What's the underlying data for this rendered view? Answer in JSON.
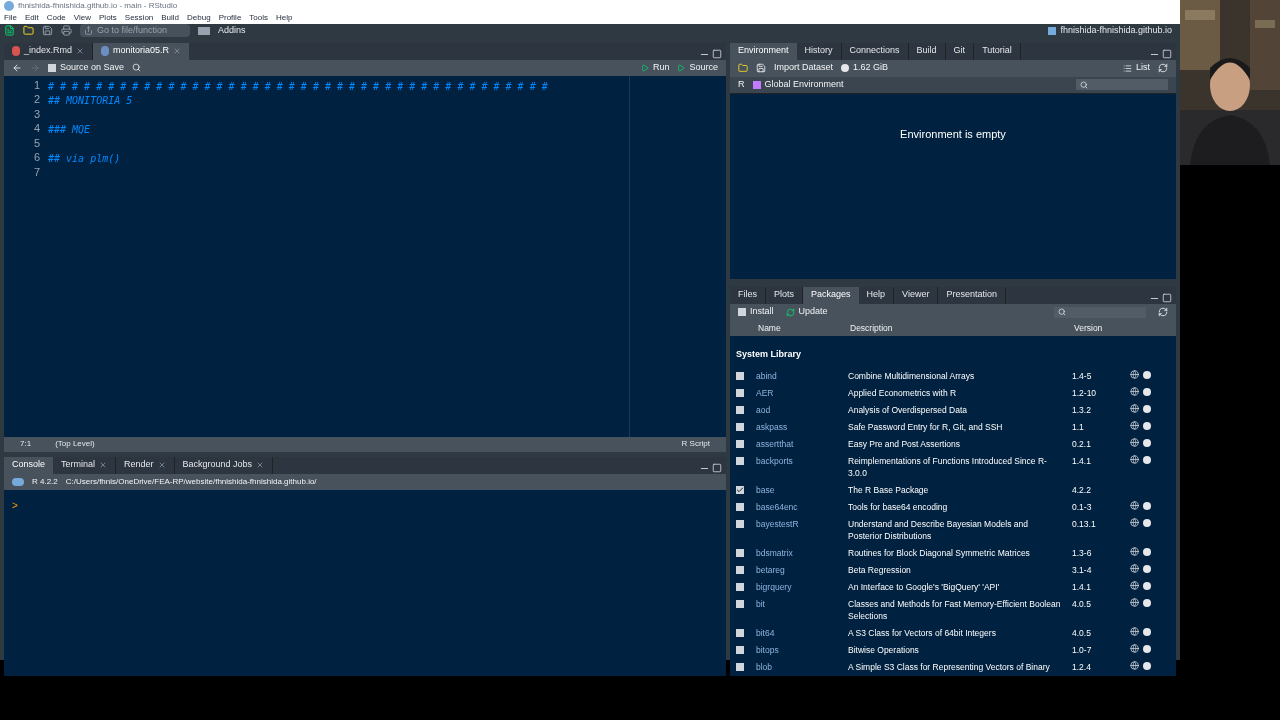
{
  "window": {
    "title": "fhnishida-fhnishida.github.io - main - RStudio"
  },
  "menu": [
    "File",
    "Edit",
    "Code",
    "View",
    "Plots",
    "Session",
    "Build",
    "Debug",
    "Profile",
    "Tools",
    "Help"
  ],
  "toolbar": {
    "goto_placeholder": "Go to file/function",
    "addins": "Addins",
    "project": "fhnishida-fhnishida.github.io"
  },
  "source": {
    "tabs": [
      {
        "label": "_index.Rmd",
        "selected": false,
        "kind": "rmd"
      },
      {
        "label": "monitoria05.R",
        "selected": true,
        "kind": "r"
      }
    ],
    "source_on_save": "Source on Save",
    "source_on_save_checked": false,
    "run": "Run",
    "source": "Source",
    "lines": [
      {
        "number": "1",
        "text": "# # # # # # # # # # # # # # # # # # # # # # # # # # # # # # # # # # # # # # # # # #"
      },
      {
        "number": "2",
        "text": "## MONITORIA 5"
      },
      {
        "number": "3"
      },
      {
        "number": "4",
        "text": "### MQE"
      },
      {
        "number": "5"
      },
      {
        "number": "6",
        "text": "## via plm()"
      },
      {
        "number": "7"
      }
    ],
    "position": "7:1",
    "scope": "(Top Level)",
    "filetype": "R Script"
  },
  "console": {
    "tabs": [
      {
        "label": "Console",
        "selected": true,
        "closable": false
      },
      {
        "label": "Terminal",
        "selected": false,
        "closable": true
      },
      {
        "label": "Render",
        "selected": false,
        "closable": true
      },
      {
        "label": "Background Jobs",
        "selected": false,
        "closable": true
      }
    ],
    "version": "R 4.2.2",
    "path": "C:/Users/fhnis/OneDrive/FEA-RP/website/fhnishida-fhnishida.github.io/",
    "prompt": ">"
  },
  "environment": {
    "tabs": [
      {
        "label": "Environment",
        "selected": true
      },
      {
        "label": "History",
        "selected": false
      },
      {
        "label": "Connections",
        "selected": false
      },
      {
        "label": "Build",
        "selected": false
      },
      {
        "label": "Git",
        "selected": false
      },
      {
        "label": "Tutorial",
        "selected": false
      }
    ],
    "import": "Import Dataset",
    "memory": "1.62 GiB",
    "view": "List",
    "language": "R",
    "scope": "Global Environment",
    "message": "Environment is empty"
  },
  "packages": {
    "tabs": [
      {
        "label": "Files",
        "selected": false
      },
      {
        "label": "Plots",
        "selected": false
      },
      {
        "label": "Packages",
        "selected": true
      },
      {
        "label": "Help",
        "selected": false
      },
      {
        "label": "Viewer",
        "selected": false
      },
      {
        "label": "Presentation",
        "selected": false
      }
    ],
    "install": "Install",
    "update": "Update",
    "columns": [
      "Name",
      "Description",
      "Version"
    ],
    "section": "System Library",
    "rows": [
      {
        "name": "abind",
        "description": "Combine Multidimensional Arrays",
        "version": "1.4-5",
        "checked": false,
        "removable": true
      },
      {
        "name": "AER",
        "description": "Applied Econometrics with R",
        "version": "1.2-10",
        "checked": false,
        "removable": true
      },
      {
        "name": "aod",
        "description": "Analysis of Overdispersed Data",
        "version": "1.3.2",
        "checked": false,
        "removable": true
      },
      {
        "name": "askpass",
        "description": "Safe Password Entry for R, Git, and SSH",
        "version": "1.1",
        "checked": false,
        "removable": true
      },
      {
        "name": "assertthat",
        "description": "Easy Pre and Post Assertions",
        "version": "0.2.1",
        "checked": false,
        "removable": true
      },
      {
        "name": "backports",
        "description": "Reimplementations of Functions Introduced Since R-3.0.0",
        "version": "1.4.1",
        "checked": false,
        "removable": true
      },
      {
        "name": "base",
        "description": "The R Base Package",
        "version": "4.2.2",
        "checked": true,
        "removable": false
      },
      {
        "name": "base64enc",
        "description": "Tools for base64 encoding",
        "version": "0.1-3",
        "checked": false,
        "removable": true
      },
      {
        "name": "bayestestR",
        "description": "Understand and Describe Bayesian Models and Posterior Distributions",
        "version": "0.13.1",
        "checked": false,
        "removable": true
      },
      {
        "name": "bdsmatrix",
        "description": "Routines for Block Diagonal Symmetric Matrices",
        "version": "1.3-6",
        "checked": false,
        "removable": true
      },
      {
        "name": "betareg",
        "description": "Beta Regression",
        "version": "3.1-4",
        "checked": false,
        "removable": true
      },
      {
        "name": "bigrquery",
        "description": "An Interface to Google's 'BigQuery' 'API'",
        "version": "1.4.1",
        "checked": false,
        "removable": true
      },
      {
        "name": "bit",
        "description": "Classes and Methods for Fast Memory-Efficient Boolean Selections",
        "version": "4.0.5",
        "checked": false,
        "removable": true
      },
      {
        "name": "bit64",
        "description": "A S3 Class for Vectors of 64bit Integers",
        "version": "4.0.5",
        "checked": false,
        "removable": true
      },
      {
        "name": "bitops",
        "description": "Bitwise Operations",
        "version": "1.0-7",
        "checked": false,
        "removable": true
      },
      {
        "name": "blob",
        "description": "A Simple S3 Class for Representing Vectors of Binary",
        "version": "1.2.4",
        "checked": false,
        "removable": true
      }
    ]
  }
}
